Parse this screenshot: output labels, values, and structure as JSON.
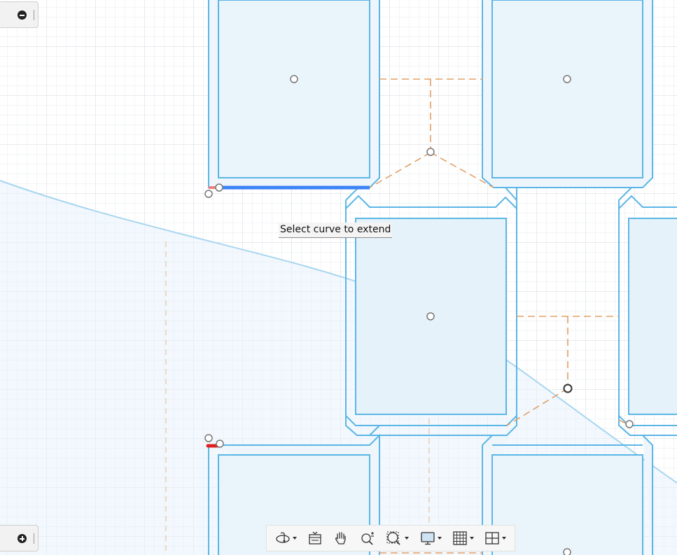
{
  "canvas": {
    "grid_color": "#e2e6ea",
    "grid_major_color": "#cfd5db",
    "profile_color": "#5ab6e6",
    "profile_fill": "#eef6fc",
    "construction_color": "#e2a067",
    "selected_color": "#3b82f6",
    "endpoint_color": "#e02020"
  },
  "tooltip": {
    "text": "Select curve to extend"
  },
  "side_buttons": [
    {
      "icon": "minus-icon"
    },
    {
      "icon": "plus-icon"
    }
  ],
  "toolbar": {
    "items": [
      {
        "name": "orbit",
        "icon": "orbit-icon",
        "has_dropdown": true
      },
      {
        "name": "look-at",
        "icon": "look-at-icon",
        "has_dropdown": false
      },
      {
        "name": "pan",
        "icon": "hand-icon",
        "has_dropdown": false
      },
      {
        "name": "zoom",
        "icon": "zoom-icon",
        "has_dropdown": false
      },
      {
        "name": "fit",
        "icon": "zoom-window-icon",
        "has_dropdown": true
      },
      {
        "name": "display-settings",
        "icon": "display-icon",
        "has_dropdown": true
      },
      {
        "name": "grid-snaps",
        "icon": "grid-icon",
        "has_dropdown": true
      },
      {
        "name": "viewports",
        "icon": "viewports-icon",
        "has_dropdown": true
      }
    ]
  }
}
